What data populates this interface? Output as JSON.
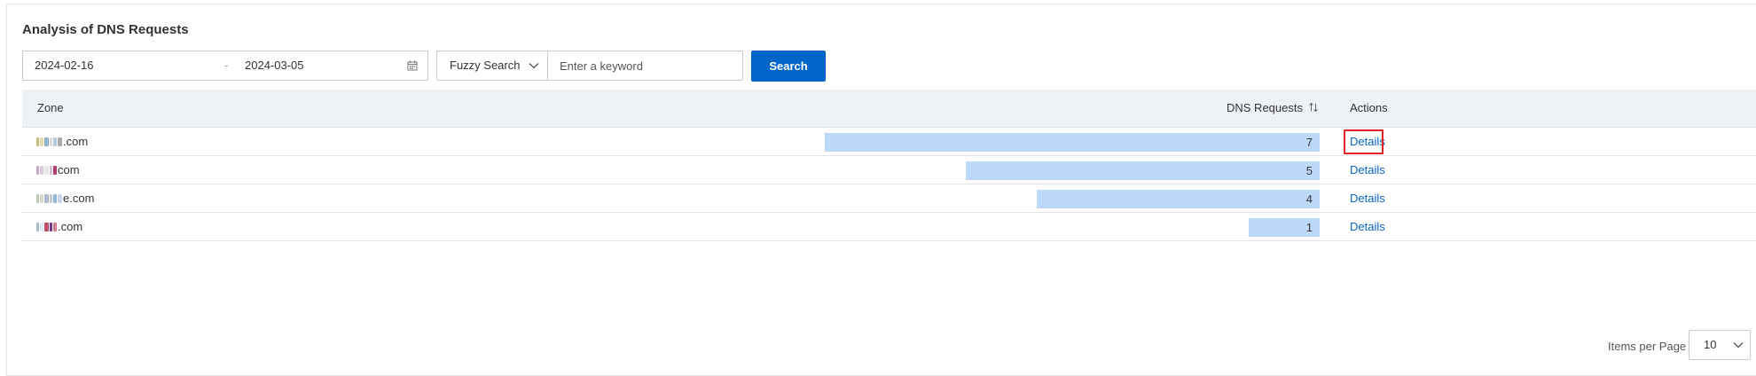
{
  "page": {
    "title": "Analysis of DNS Requests"
  },
  "filters": {
    "start_date": "2024-02-16",
    "separator": "-",
    "end_date": "2024-03-05",
    "search_mode": "Fuzzy Search",
    "keyword_placeholder": "Enter a keyword",
    "search_label": "Search"
  },
  "table": {
    "columns": {
      "zone": "Zone",
      "requests": "DNS Requests",
      "actions": "Actions"
    },
    "max_requests": 7,
    "rows": [
      {
        "zone_suffix": ".com",
        "requests": 7,
        "requests_label": "7",
        "action": "Details",
        "highlighted": true,
        "blur": [
          "#c9b97a",
          "#e8d9a8",
          "#8fb1c9",
          "#d8d8d8",
          "#b9c9d9",
          "#a8a8a8"
        ]
      },
      {
        "zone_suffix": "com",
        "requests": 5,
        "requests_label": "5",
        "action": "Details",
        "highlighted": false,
        "blur": [
          "#c9a9c9",
          "#d9c9d9",
          "#e6e6e6",
          "#d8c0d8",
          "#b04070"
        ]
      },
      {
        "zone_suffix": "e.com",
        "requests": 4,
        "requests_label": "4",
        "action": "Details",
        "highlighted": false,
        "blur": [
          "#b9c9b9",
          "#d9d9c9",
          "#a9b9c9",
          "#c9c9c9",
          "#8fb9d9",
          "#c8d8e8"
        ]
      },
      {
        "zone_suffix": ".com",
        "requests": 1,
        "requests_label": "1",
        "action": "Details",
        "highlighted": false,
        "blur": [
          "#a9b9c9",
          "#d9e9f9",
          "#c0506a",
          "#7a3a8a",
          "#d08090"
        ]
      }
    ]
  },
  "pager": {
    "label": "Items per Page",
    "page_size": "10"
  },
  "colors": {
    "primary": "#0064c8",
    "bar": "#bcd9fa",
    "highlight": "#e0242a"
  },
  "icons": {
    "calendar": "calendar-icon",
    "dropdown": "chevron-down-icon",
    "sort": "sort-icon"
  }
}
